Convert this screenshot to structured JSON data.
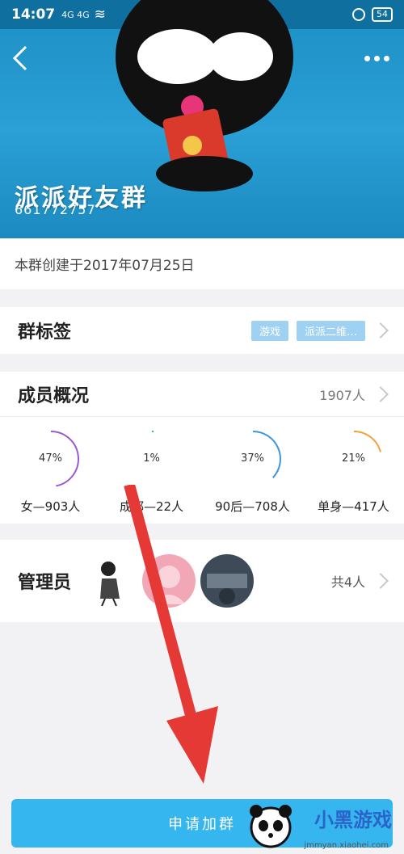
{
  "status_bar": {
    "time": "14:07",
    "signal": "4G 4G",
    "battery": "54"
  },
  "header": {
    "group_name": "派派好友群",
    "group_id": "661772757"
  },
  "info": {
    "created_text": "本群创建于2017年07月25日"
  },
  "tags_section": {
    "label": "群标签",
    "tags": [
      "游戏",
      "派派二维…"
    ]
  },
  "members_section": {
    "label": "成员概况",
    "count": "1907人",
    "stats": [
      {
        "percent_text": "47%",
        "label": "女—903人",
        "fraction": 0.47,
        "color": "#9b59d6"
      },
      {
        "percent_text": "1%",
        "label": "成都—22人",
        "fraction": 0.01,
        "color": "#2ab3a8"
      },
      {
        "percent_text": "37%",
        "label": "90后—708人",
        "fraction": 0.37,
        "color": "#3d94e0"
      },
      {
        "percent_text": "21%",
        "label": "单身—417人",
        "fraction": 0.21,
        "color": "#f0a23a"
      }
    ]
  },
  "admin_section": {
    "label": "管理员",
    "count": "共4人"
  },
  "bottom": {
    "apply_label": "申请加群"
  },
  "branding": {
    "logo_text": "小黑游戏",
    "logo_url": "jmmyan.xiaohei.com"
  }
}
